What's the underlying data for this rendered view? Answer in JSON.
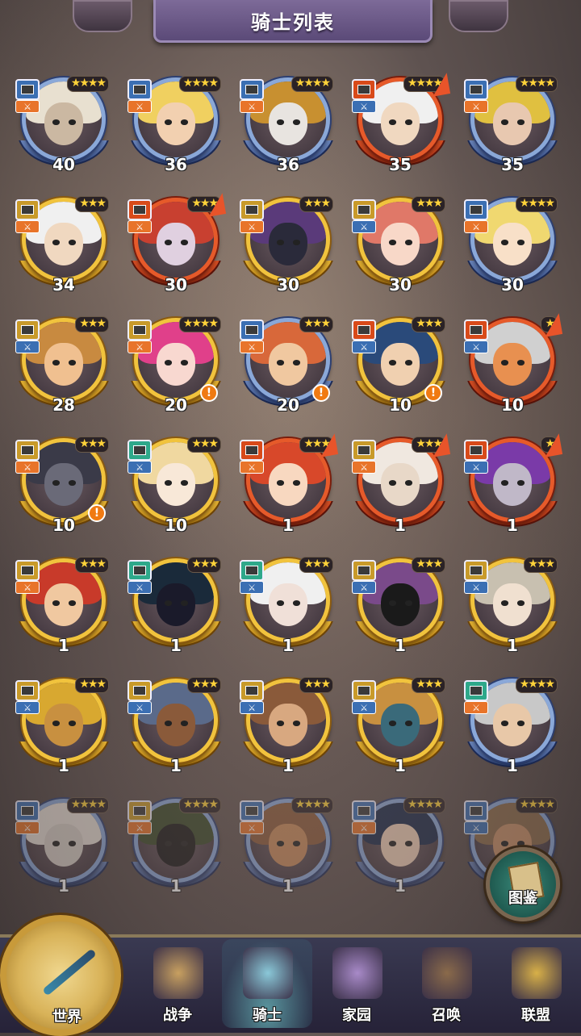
{
  "header": {
    "title": "骑士列表"
  },
  "knights": [
    {
      "level": "40",
      "stars": "★★★★",
      "frame": "blue",
      "class_color": "#3b6fb3",
      "type_color": "#e8742a",
      "hair": "#e8e0d0",
      "skin": "#cbb8a2",
      "upgrade": false,
      "alert": false
    },
    {
      "level": "36",
      "stars": "★★★★",
      "frame": "blue",
      "class_color": "#3b6fb3",
      "type_color": "#e8742a",
      "hair": "#f0d060",
      "skin": "#f2d0b0",
      "upgrade": false,
      "alert": false
    },
    {
      "level": "36",
      "stars": "★★★★",
      "frame": "blue",
      "class_color": "#3b6fb3",
      "type_color": "#e8742a",
      "hair": "#c89030",
      "skin": "#e8e4e0",
      "upgrade": false,
      "alert": false
    },
    {
      "level": "35",
      "stars": "★★★★",
      "frame": "red",
      "class_color": "#d84a1a",
      "type_color": "#3b6fb3",
      "hair": "#f0f0f0",
      "skin": "#f0d8c0",
      "upgrade": true,
      "alert": false
    },
    {
      "level": "35",
      "stars": "★★★★",
      "frame": "blue",
      "class_color": "#3b6fb3",
      "type_color": "#e8742a",
      "hair": "#e0c040",
      "skin": "#e8c8b0",
      "upgrade": false,
      "alert": false
    },
    {
      "level": "34",
      "stars": "★★★",
      "frame": "gold",
      "class_color": "#c89a2a",
      "type_color": "#e8742a",
      "hair": "#f0f0f0",
      "skin": "#f0d8c0",
      "upgrade": false,
      "alert": false
    },
    {
      "level": "30",
      "stars": "★★★",
      "frame": "red",
      "class_color": "#d84a1a",
      "type_color": "#e8742a",
      "hair": "#c84030",
      "skin": "#e0d0e0",
      "upgrade": true,
      "alert": false
    },
    {
      "level": "30",
      "stars": "★★★",
      "frame": "gold",
      "class_color": "#c89a2a",
      "type_color": "#e8742a",
      "hair": "#5a3a7a",
      "skin": "#2a2a3a",
      "upgrade": false,
      "alert": false
    },
    {
      "level": "30",
      "stars": "★★★",
      "frame": "gold",
      "class_color": "#c89a2a",
      "type_color": "#3b6fb3",
      "hair": "#e07868",
      "skin": "#f8d8c8",
      "upgrade": false,
      "alert": false
    },
    {
      "level": "30",
      "stars": "★★★★",
      "frame": "blue",
      "class_color": "#3b6fb3",
      "type_color": "#e8742a",
      "hair": "#f0d870",
      "skin": "#f8e0c8",
      "upgrade": false,
      "alert": false
    },
    {
      "level": "28",
      "stars": "★★★",
      "frame": "gold",
      "class_color": "#c89a2a",
      "type_color": "#3b6fb3",
      "hair": "#c88a40",
      "skin": "#f0c090",
      "upgrade": false,
      "alert": false
    },
    {
      "level": "20",
      "stars": "★★★★",
      "frame": "gold",
      "class_color": "#c89a2a",
      "type_color": "#e8742a",
      "hair": "#e0408a",
      "skin": "#f8d8d0",
      "upgrade": false,
      "alert": true
    },
    {
      "level": "20",
      "stars": "★★★",
      "frame": "blue",
      "class_color": "#3b6fb3",
      "type_color": "#e8742a",
      "hair": "#d8683a",
      "skin": "#f0c8a0",
      "upgrade": false,
      "alert": true
    },
    {
      "level": "10",
      "stars": "★★★",
      "frame": "gold",
      "class_color": "#d84a1a",
      "type_color": "#3b6fb3",
      "hair": "#2a4a7a",
      "skin": "#f0d0b0",
      "upgrade": false,
      "alert": true
    },
    {
      "level": "10",
      "stars": "★",
      "frame": "red",
      "class_color": "#d84a1a",
      "type_color": "#3b6fb3",
      "hair": "#d0d0d0",
      "skin": "#e89050",
      "upgrade": true,
      "alert": false
    },
    {
      "level": "10",
      "stars": "★★★",
      "frame": "gold",
      "class_color": "#c89a2a",
      "type_color": "#e8742a",
      "hair": "#3a3a48",
      "skin": "#6a6a78",
      "upgrade": false,
      "alert": true
    },
    {
      "level": "10",
      "stars": "★★★",
      "frame": "gold",
      "class_color": "#2ea88a",
      "type_color": "#3b6fb3",
      "hair": "#f0d8a0",
      "skin": "#f8e8d8",
      "upgrade": false,
      "alert": false
    },
    {
      "level": "1",
      "stars": "★★★",
      "frame": "red",
      "class_color": "#d84a1a",
      "type_color": "#e8742a",
      "hair": "#d8482a",
      "skin": "#f8d8c0",
      "upgrade": true,
      "alert": false
    },
    {
      "level": "1",
      "stars": "★★★",
      "frame": "red",
      "class_color": "#c89a2a",
      "type_color": "#e8742a",
      "hair": "#f0e8e0",
      "skin": "#e8d8c8",
      "upgrade": true,
      "alert": false
    },
    {
      "level": "1",
      "stars": "★",
      "frame": "red",
      "class_color": "#d84a1a",
      "type_color": "#3b6fb3",
      "hair": "#7a3aa8",
      "skin": "#c0b8c8",
      "upgrade": true,
      "alert": false
    },
    {
      "level": "1",
      "stars": "★★★",
      "frame": "gold",
      "class_color": "#c89a2a",
      "type_color": "#e8742a",
      "hair": "#c83a2a",
      "skin": "#f0c8a0",
      "upgrade": false,
      "alert": false
    },
    {
      "level": "1",
      "stars": "★★★",
      "frame": "gold",
      "class_color": "#2ea88a",
      "type_color": "#3b6fb3",
      "hair": "#1a2a3a",
      "skin": "#1a1a2a",
      "upgrade": false,
      "alert": false
    },
    {
      "level": "1",
      "stars": "★★★",
      "frame": "gold",
      "class_color": "#2ea88a",
      "type_color": "#3b6fb3",
      "hair": "#f0f0f0",
      "skin": "#f0e0d8",
      "upgrade": false,
      "alert": false
    },
    {
      "level": "1",
      "stars": "★★★",
      "frame": "gold",
      "class_color": "#c89a2a",
      "type_color": "#3b6fb3",
      "hair": "#7a4a8a",
      "skin": "#1a1a1a",
      "upgrade": false,
      "alert": false
    },
    {
      "level": "1",
      "stars": "★★★",
      "frame": "gold",
      "class_color": "#c89a2a",
      "type_color": "#3b6fb3",
      "hair": "#c8c0b0",
      "skin": "#f0e0d0",
      "upgrade": false,
      "alert": false
    },
    {
      "level": "1",
      "stars": "★★★",
      "frame": "gold",
      "class_color": "#c89a2a",
      "type_color": "#3b6fb3",
      "hair": "#d8a830",
      "skin": "#c89040",
      "upgrade": false,
      "alert": false
    },
    {
      "level": "1",
      "stars": "★★★",
      "frame": "gold",
      "class_color": "#c89a2a",
      "type_color": "#3b6fb3",
      "hair": "#5a6a8a",
      "skin": "#8a5a3a",
      "upgrade": false,
      "alert": false
    },
    {
      "level": "1",
      "stars": "★★★",
      "frame": "gold",
      "class_color": "#c89a2a",
      "type_color": "#3b6fb3",
      "hair": "#8a5a3a",
      "skin": "#d8a880",
      "upgrade": false,
      "alert": false
    },
    {
      "level": "1",
      "stars": "★★★",
      "frame": "gold",
      "class_color": "#c89a2a",
      "type_color": "#3b6fb3",
      "hair": "#c89040",
      "skin": "#3a6a7a",
      "upgrade": false,
      "alert": false
    },
    {
      "level": "1",
      "stars": "★★★★",
      "frame": "blue",
      "class_color": "#2ea88a",
      "type_color": "#e8742a",
      "hair": "#c8c8c8",
      "skin": "#e8c8a8",
      "upgrade": false,
      "alert": false
    },
    {
      "level": "1",
      "stars": "★★★★",
      "frame": "blue",
      "class_color": "#3b6fb3",
      "type_color": "#e8742a",
      "hair": "#e8e0d8",
      "skin": "#d8d0c8",
      "upgrade": false,
      "alert": false,
      "faded": true
    },
    {
      "level": "1",
      "stars": "★★★★",
      "frame": "blue",
      "class_color": "#c89a2a",
      "type_color": "#e8742a",
      "hair": "#3a4a2a",
      "skin": "#1a1a1a",
      "upgrade": false,
      "alert": false,
      "faded": true
    },
    {
      "level": "1",
      "stars": "★★★★",
      "frame": "blue",
      "class_color": "#3b6fb3",
      "type_color": "#e8742a",
      "hair": "#8a5a3a",
      "skin": "#c88a5a",
      "upgrade": false,
      "alert": false,
      "faded": true
    },
    {
      "level": "1",
      "stars": "★★★★",
      "frame": "blue",
      "class_color": "#3b6fb3",
      "type_color": "#e8742a",
      "hair": "#1a2a4a",
      "skin": "#f0d0b8",
      "upgrade": false,
      "alert": false,
      "faded": true
    },
    {
      "level": "1",
      "stars": "★★★★",
      "frame": "blue",
      "class_color": "#3b6fb3",
      "type_color": "#3b6fb3",
      "hair": "#8a6a4a",
      "skin": "#c89068",
      "upgrade": false,
      "alert": false,
      "faded": true
    }
  ],
  "codex": {
    "label": "图鉴",
    "icon": "book-icon"
  },
  "nav": {
    "world": {
      "label": "世界",
      "icon": "compass-icon"
    },
    "items": [
      {
        "label": "战争",
        "icon": "war-map-icon",
        "color": "#c8a060",
        "active": false
      },
      {
        "label": "骑士",
        "icon": "knight-icon",
        "color": "#8ac8d8",
        "active": true
      },
      {
        "label": "家园",
        "icon": "home-tent-icon",
        "color": "#a88ac8",
        "active": false
      },
      {
        "label": "召唤",
        "icon": "train-icon",
        "color": "#8a6a4a",
        "active": false
      },
      {
        "label": "联盟",
        "icon": "alliance-icon",
        "color": "#d8b048",
        "active": false
      }
    ]
  }
}
